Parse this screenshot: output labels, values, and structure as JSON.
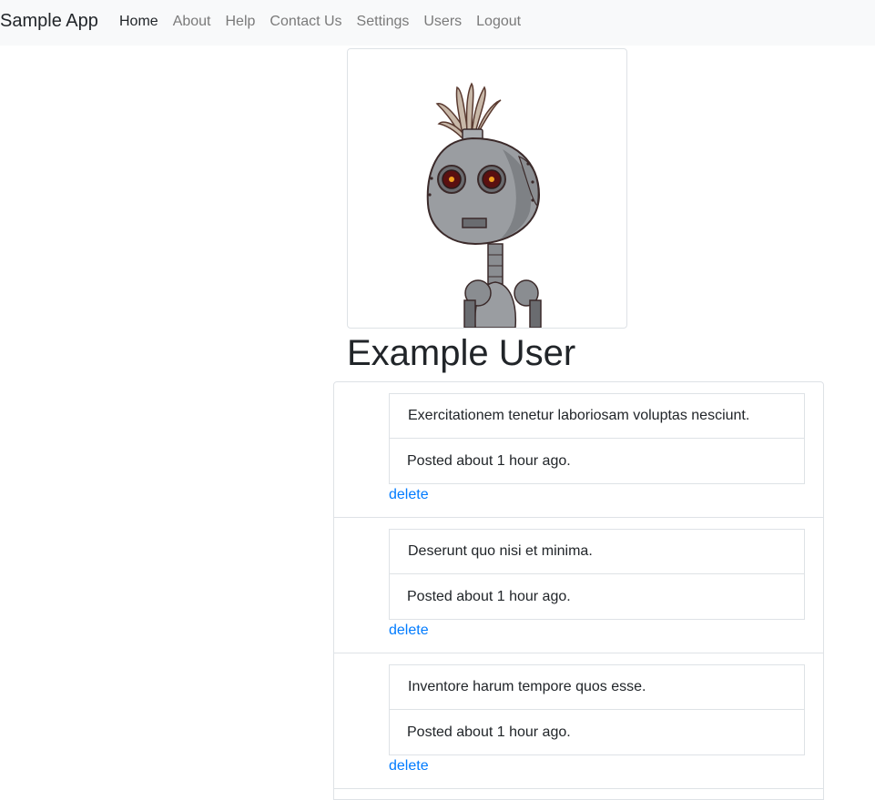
{
  "navbar": {
    "brand": "Sample App",
    "links": [
      {
        "label": "Home",
        "active": true
      },
      {
        "label": "About"
      },
      {
        "label": "Help"
      },
      {
        "label": "Contact Us"
      },
      {
        "label": "Settings"
      },
      {
        "label": "Users"
      },
      {
        "label": "Logout"
      }
    ]
  },
  "profile": {
    "avatar_icon": "robot-avatar-image",
    "name": "Example User"
  },
  "posts": [
    {
      "content": "Exercitationem tenetur laboriosam voluptas nesciunt.",
      "timestamp": "Posted about 1 hour ago.",
      "action": "delete"
    },
    {
      "content": "Deserunt quo nisi et minima.",
      "timestamp": "Posted about 1 hour ago.",
      "action": "delete"
    },
    {
      "content": "Inventore harum tempore quos esse.",
      "timestamp": "Posted about 1 hour ago.",
      "action": "delete"
    }
  ],
  "colors": {
    "navbar_bg": "#f8f9fa",
    "link": "#007bff",
    "nav_muted": "#7a7a7a",
    "border": "#dee2e6"
  }
}
